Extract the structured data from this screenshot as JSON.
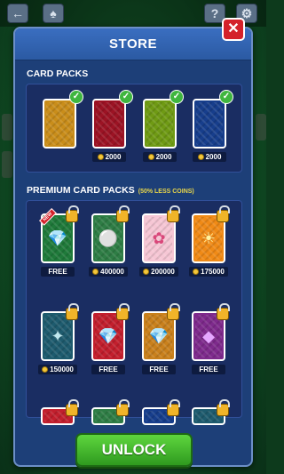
{
  "store": {
    "title": "STORE",
    "close_glyph": "✕",
    "unlock_label": "UNLOCK",
    "card_packs": {
      "label": "CARD PACKS",
      "items": [
        {
          "color": "#c98d1a",
          "price": "",
          "owned": true
        },
        {
          "color": "#9c1324",
          "price": "2000",
          "owned": true
        },
        {
          "color": "#6f9a14",
          "price": "2000",
          "owned": true
        },
        {
          "color": "#173e8c",
          "price": "2000",
          "owned": true
        }
      ]
    },
    "premium": {
      "label": "PREMIUM CARD PACKS",
      "note": "(50% LESS COINS)",
      "new_badge": "NEW",
      "items": [
        {
          "color": "#1f7a3a",
          "motif": "diamond-crown",
          "price": "FREE"
        },
        {
          "color": "#2e7d45",
          "motif": "golf-ball",
          "price": "400000"
        },
        {
          "color": "#f6c6d4",
          "motif": "flower",
          "price": "200000"
        },
        {
          "color": "#f08a16",
          "motif": "sun-flower",
          "price": "175000"
        },
        {
          "color": "#1e5b6e",
          "motif": "compass",
          "price": "150000"
        },
        {
          "color": "#c21f2d",
          "motif": "diamond-crown",
          "price": "FREE"
        },
        {
          "color": "#c9801c",
          "motif": "diamond-crown",
          "price": "FREE"
        },
        {
          "color": "#7e2a8c",
          "motif": "purple-gem",
          "price": "FREE"
        }
      ]
    }
  }
}
